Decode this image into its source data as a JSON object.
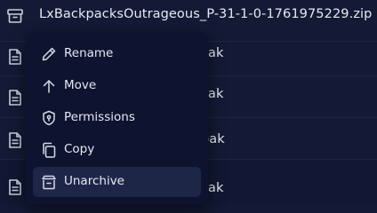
{
  "colors": {
    "background": "#141a35",
    "menu_background": "#0e1330",
    "menu_active": "#1e2648",
    "text": "#e6e8f2"
  },
  "files": [
    {
      "name": "LxBackpacksOutrageous_P-31-1-0-1761975229.zip",
      "icon": "archive-icon"
    },
    {
      "name": "ak",
      "icon": "file-icon"
    },
    {
      "name": "ak",
      "icon": "file-icon"
    },
    {
      "name": "bak",
      "icon": "file-icon"
    },
    {
      "name": "ak",
      "icon": "file-icon"
    }
  ],
  "context_menu": {
    "items": [
      {
        "label": "Rename",
        "icon": "pencil-icon"
      },
      {
        "label": "Move",
        "icon": "arrow-up-icon"
      },
      {
        "label": "Permissions",
        "icon": "shield-icon"
      },
      {
        "label": "Copy",
        "icon": "copy-icon"
      },
      {
        "label": "Unarchive",
        "icon": "unarchive-icon",
        "active": true
      }
    ]
  }
}
